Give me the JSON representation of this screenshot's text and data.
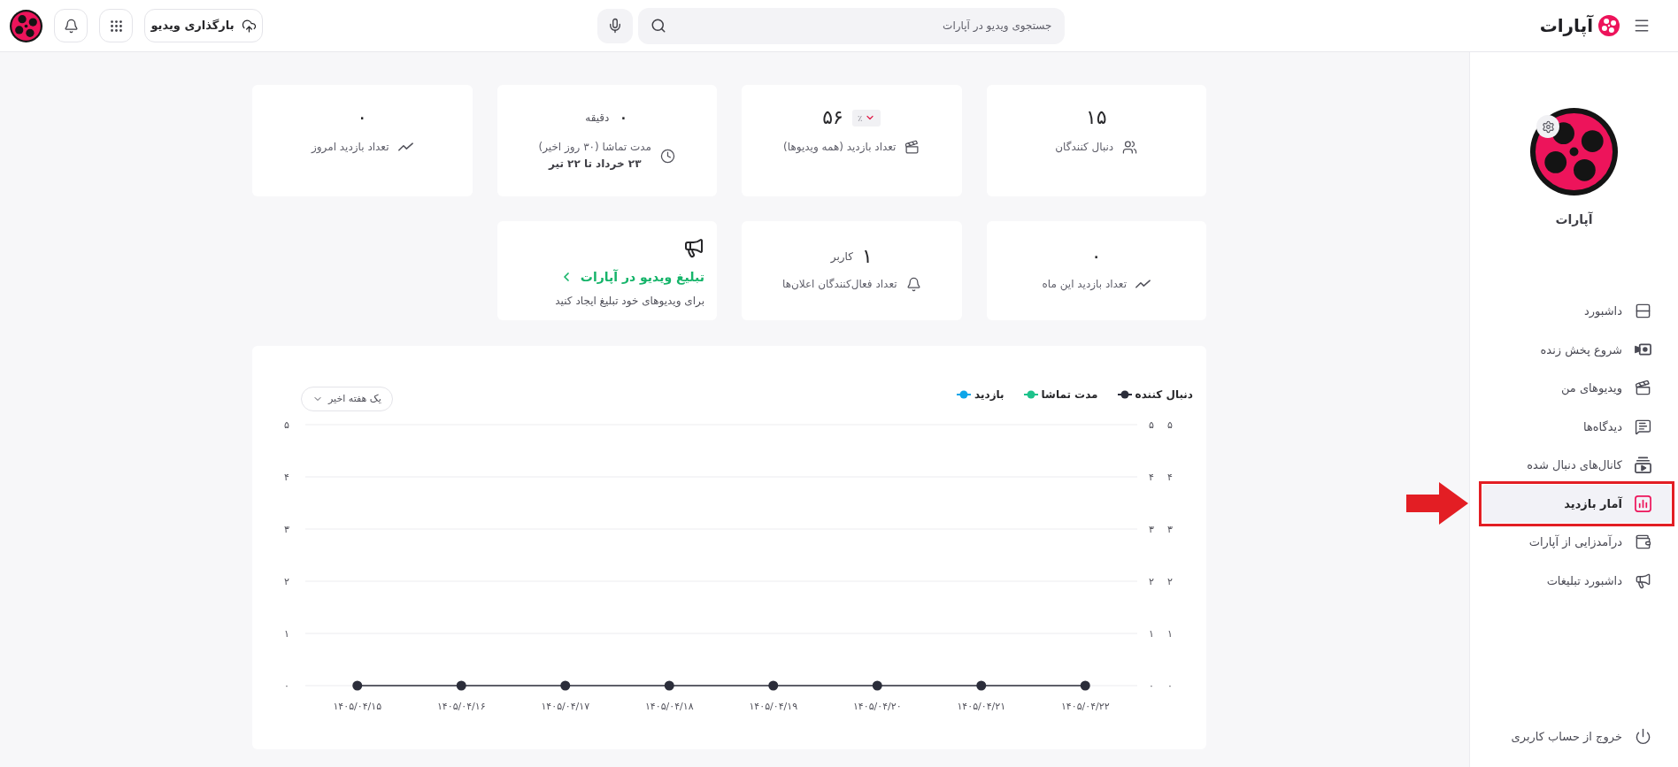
{
  "top_bar": {
    "logo": {
      "text": "آپارات"
    },
    "search": {
      "placeholder": "جستجوی ویدیو در آپارات"
    },
    "upload_button": {
      "label": "بارگذاری ویدیو"
    }
  },
  "sidebar": {
    "channel_name": "آپارات",
    "items": [
      {
        "label": "داشبورد",
        "selected": false,
        "highlighted": false
      },
      {
        "label": "شروع پخش زنده",
        "selected": false,
        "highlighted": false
      },
      {
        "label": "ویدیوهای من",
        "selected": false,
        "highlighted": false
      },
      {
        "label": "دیدگاه‌ها",
        "selected": false,
        "highlighted": false
      },
      {
        "label": "کانال‌های دنبال شده",
        "selected": false,
        "highlighted": false
      },
      {
        "label": "آمار بازدید",
        "selected": true,
        "highlighted": true
      },
      {
        "label": "درآمدزایی از آپارات",
        "selected": false,
        "highlighted": false
      },
      {
        "label": "داشبورد تبلیغات",
        "selected": false,
        "highlighted": false
      }
    ],
    "logout": {
      "label": "خروج از حساب کاربری"
    }
  },
  "stats": [
    {
      "value": "۱۵",
      "label": "دنبال کنندگان"
    },
    {
      "value": "۵۶",
      "label": "تعداد بازدید (همه ویدیوها)",
      "change": {
        "text": "٪",
        "decrease": true
      }
    },
    {
      "value": "۰",
      "unit": "دقیقه",
      "label": "مدت تماشا (۳۰ روز اخیر)",
      "sublabel": "۲۳ خرداد تا ۲۲ تیر"
    },
    {
      "value": "۰",
      "label": "تعداد بازدید امروز"
    },
    {
      "value": "۰",
      "label": "تعداد بازدید این ماه"
    },
    {
      "value": "۱",
      "unit": "کاربر",
      "label": "تعداد فعال‌کنندگان اعلان‌ها"
    }
  ],
  "promo": {
    "title": "تبلیغ ویدیو در آپارات",
    "subtitle": "برای ویدیوهای خود تبلیغ ایجاد کنید"
  },
  "chart": {
    "range_select": {
      "value": "یک هفته اخیر"
    },
    "right_axes": [
      {
        "ticks": [
          "۵",
          "۴",
          "۳",
          "۲",
          "۱",
          "۰"
        ]
      },
      {
        "ticks": [
          "۵",
          "۴",
          "۳",
          "۲",
          "۱",
          "۰"
        ]
      }
    ],
    "chart_data": {
      "type": "line",
      "grid": true,
      "categories": [
        "۱۴۰۵/۰۴/۱۵",
        "۱۴۰۵/۰۴/۱۶",
        "۱۴۰۵/۰۴/۱۷",
        "۱۴۰۵/۰۴/۱۸",
        "۱۴۰۵/۰۴/۱۹",
        "۱۴۰۵/۰۴/۲۰",
        "۱۴۰۵/۰۴/۲۱",
        "۱۴۰۵/۰۴/۲۲"
      ],
      "series": [
        {
          "name": "دنبال کننده",
          "color": "#2b2d3a",
          "marker": "circle",
          "values": [
            0,
            0,
            0,
            0,
            0,
            0,
            0,
            0
          ]
        },
        {
          "name": "مدت تماشا",
          "color": "#1ec28b",
          "values": [
            null,
            null,
            null,
            null,
            null,
            null,
            null,
            null
          ]
        },
        {
          "name": "بازدید",
          "color": "#0ea5e9",
          "values": [
            null,
            null,
            null,
            null,
            null,
            null,
            null,
            null
          ]
        }
      ],
      "ylim": [
        0,
        5
      ],
      "yticks": [
        {
          "value": 0,
          "label": "۰"
        },
        {
          "value": 1,
          "label": "۱"
        },
        {
          "value": 2,
          "label": "۲"
        },
        {
          "value": 3,
          "label": "۳"
        },
        {
          "value": 4,
          "label": "۴"
        },
        {
          "value": 5,
          "label": "۵"
        }
      ]
    }
  }
}
